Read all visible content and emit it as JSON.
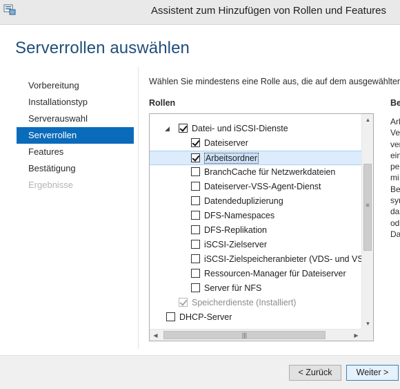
{
  "window": {
    "title": "Assistent zum Hinzufügen von Rollen und Features",
    "app_icon": "server-manager-icon"
  },
  "page_title": "Serverrollen auswählen",
  "nav": {
    "items": [
      {
        "label": "Vorbereitung",
        "state": "normal"
      },
      {
        "label": "Installationstyp",
        "state": "normal"
      },
      {
        "label": "Serverauswahl",
        "state": "normal"
      },
      {
        "label": "Serverrollen",
        "state": "active"
      },
      {
        "label": "Features",
        "state": "normal"
      },
      {
        "label": "Bestätigung",
        "state": "normal"
      },
      {
        "label": "Ergebnisse",
        "state": "disabled"
      }
    ]
  },
  "main": {
    "instruction": "Wählen Sie mindestens eine Rolle aus, die auf dem ausgewählten Server",
    "roles_header": "Rollen",
    "description_header": "Be",
    "description_lines": [
      "Arl",
      "Ve",
      "ver",
      "ein",
      "pe",
      "mi",
      "Be",
      "syn",
      "da",
      "od",
      "Da"
    ]
  },
  "roles": [
    {
      "label": "Datei- und iSCSI-Dienste",
      "level": 1,
      "checked": true,
      "expander": "collapse-arrow-icon",
      "disabled": false,
      "selected": false
    },
    {
      "label": "Dateiserver",
      "level": 2,
      "checked": true,
      "disabled": false,
      "selected": false
    },
    {
      "label": "Arbeitsordner",
      "level": 2,
      "checked": true,
      "disabled": false,
      "selected": true
    },
    {
      "label": "BranchCache für Netzwerkdateien",
      "level": 2,
      "checked": false,
      "disabled": false,
      "selected": false
    },
    {
      "label": "Dateiserver-VSS-Agent-Dienst",
      "level": 2,
      "checked": false,
      "disabled": false,
      "selected": false
    },
    {
      "label": "Datendeduplizierung",
      "level": 2,
      "checked": false,
      "disabled": false,
      "selected": false
    },
    {
      "label": "DFS-Namespaces",
      "level": 2,
      "checked": false,
      "disabled": false,
      "selected": false
    },
    {
      "label": "DFS-Replikation",
      "level": 2,
      "checked": false,
      "disabled": false,
      "selected": false
    },
    {
      "label": "iSCSI-Zielserver",
      "level": 2,
      "checked": false,
      "disabled": false,
      "selected": false
    },
    {
      "label": "iSCSI-Zielspeicheranbieter (VDS- und VSS-H",
      "level": 2,
      "checked": false,
      "disabled": false,
      "selected": false
    },
    {
      "label": "Ressourcen-Manager für Dateiserver",
      "level": 2,
      "checked": false,
      "disabled": false,
      "selected": false
    },
    {
      "label": "Server für NFS",
      "level": 2,
      "checked": false,
      "disabled": false,
      "selected": false
    },
    {
      "label": "Speicherdienste (Installiert)",
      "level": 1,
      "checked": true,
      "disabled": true,
      "selected": false
    },
    {
      "label": "DHCP-Server",
      "level": 0,
      "checked": false,
      "disabled": false,
      "selected": false
    }
  ],
  "footer": {
    "back_label": "< Zurück",
    "next_label": "Weiter >"
  },
  "colors": {
    "accent": "#0b6bbb",
    "title": "#1f4e79",
    "selection": "#dcecfc"
  }
}
